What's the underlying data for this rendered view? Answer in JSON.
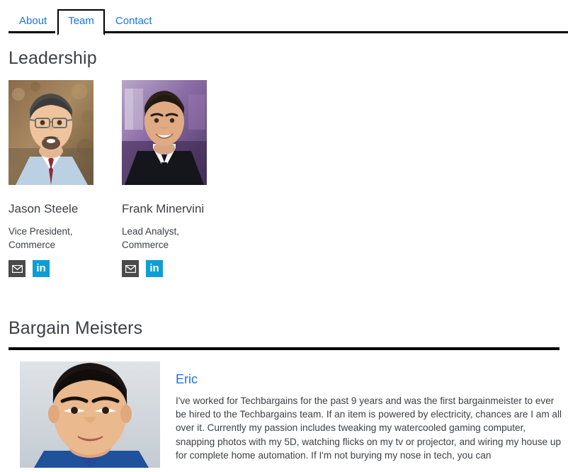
{
  "nav": {
    "tabs": [
      {
        "label": "About",
        "active": false
      },
      {
        "label": "Team",
        "active": true
      },
      {
        "label": "Contact",
        "active": false
      }
    ]
  },
  "leadership": {
    "heading": "Leadership",
    "members": [
      {
        "name": "Jason Steele",
        "role": "Vice President, Commerce",
        "photo_alt": "portrait of man with glasses and goatee wearing light blue shirt with autumn foliage background",
        "social": [
          {
            "icon": "mail-icon",
            "label": "Email"
          },
          {
            "icon": "linkedin-icon",
            "label": "in"
          }
        ]
      },
      {
        "name": "Frank Minervini",
        "role": "Lead Analyst, Commerce",
        "photo_alt": "portrait of smiling man in black suit white shirt and black tie with purple lit background",
        "social": [
          {
            "icon": "mail-icon",
            "label": "Email"
          },
          {
            "icon": "linkedin-icon",
            "label": "in"
          }
        ]
      }
    ]
  },
  "bargain_meisters": {
    "heading": "Bargain Meisters",
    "members": [
      {
        "name": "Eric",
        "photo_alt": "close-up portrait of smiling man with short dark hair and blue collar on light gray background",
        "bio": "I've worked for Techbargains for the past 9 years and was the first bargainmeister to ever be hired to the Techbargains team. If an item is powered by electricity, chances are I am all over it. Currently my passion includes tweaking my watercooled gaming computer, snapping photos with my 5D, watching flicks on my tv or projector, and wiring my house up for complete home automation. If I'm not burying my nose in tech, you can"
      }
    ]
  },
  "colors": {
    "link": "#1a73e8",
    "heading": "#3c4043",
    "rule": "#000000",
    "mail_bg": "#4a4a4a",
    "linkedin_bg": "#0e9ed5"
  }
}
